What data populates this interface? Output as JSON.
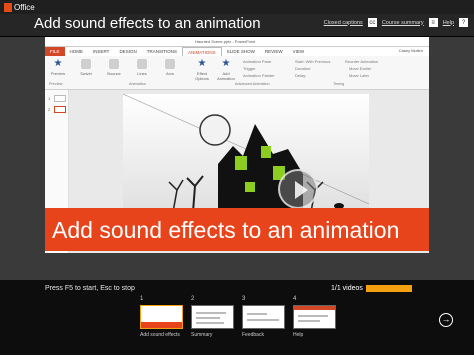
{
  "header": {
    "brand": "Office",
    "title": "Add sound effects to an animation",
    "links": [
      {
        "label": "Closed captions",
        "icon": "cc-icon",
        "glyph": "cc"
      },
      {
        "label": "Course summary",
        "icon": "summary-icon",
        "glyph": "≡"
      },
      {
        "label": "Help",
        "icon": "help-icon",
        "glyph": "?"
      }
    ]
  },
  "video": {
    "ppt": {
      "doc_title": "Haunted Scene.pptx - PowerPoint",
      "user": "Casey Mullen",
      "tabs": [
        "FILE",
        "HOME",
        "INSERT",
        "DESIGN",
        "TRANSITIONS",
        "ANIMATIONS",
        "SLIDE SHOW",
        "REVIEW",
        "VIEW"
      ],
      "active_tab": "ANIMATIONS",
      "ribbon": {
        "preview": "Preview",
        "effects": [
          "Swivel",
          "Bounce",
          "Lines",
          "Arcs"
        ],
        "effect_options": "Effect Options",
        "add_animation": "Add Animation",
        "animation_pane": "Animation Pane",
        "trigger": "Trigger",
        "animation_painter": "Animation Painter",
        "start": "Start: With Previous",
        "duration": "Duration:",
        "delay": "Delay:",
        "reorder": "Reorder Animation",
        "move_earlier": "Move Earlier",
        "move_later": "Move Later",
        "groups": [
          "Preview",
          "Animation",
          "Advanced Animation",
          "Timing"
        ]
      },
      "slide_numbers": [
        "1",
        "2"
      ]
    },
    "banner_text": "Add sound effects to an animation"
  },
  "bottom": {
    "hint": "Press F5 to start, Esc to stop",
    "videos_count": "1/1 videos",
    "progress": 1.0,
    "accent": "#f4a011",
    "chapters": [
      {
        "num": "1",
        "label": "Add sound effects"
      },
      {
        "num": "2",
        "label": "Summary"
      },
      {
        "num": "3",
        "label": "Feedback"
      },
      {
        "num": "4",
        "label": "Help"
      }
    ],
    "next_icon": "next-arrow-icon"
  }
}
